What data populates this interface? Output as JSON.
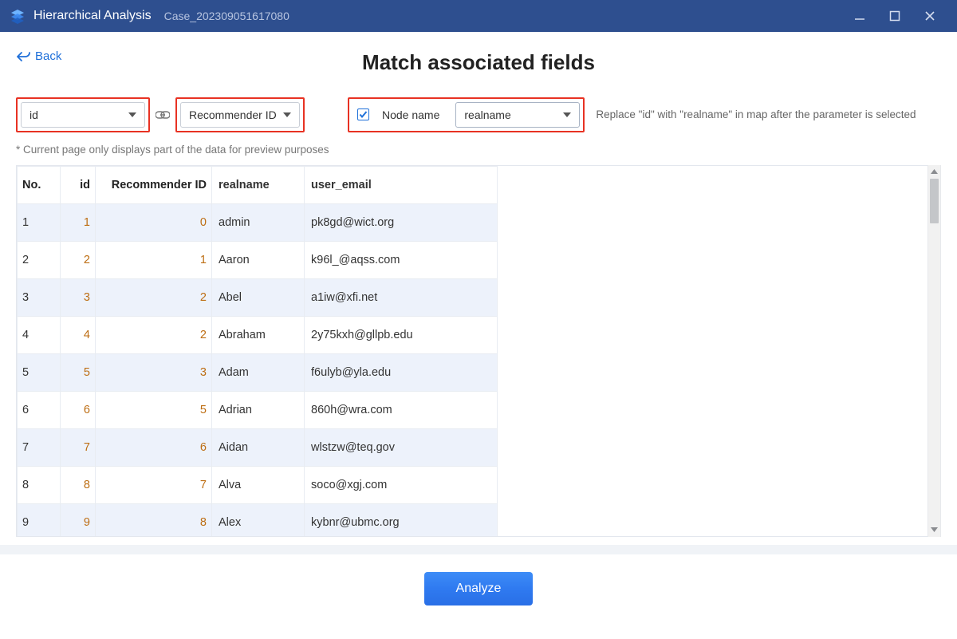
{
  "titlebar": {
    "app_title": "Hierarchical Analysis",
    "case_label": "Case_202309051617080"
  },
  "header": {
    "back_label": "Back",
    "page_title": "Match associated fields"
  },
  "controls": {
    "select_id_value": "id",
    "select_rec_value": "Recommender ID",
    "node_name_checked": true,
    "node_name_label": "Node name",
    "select_nodename_value": "realname",
    "help_text": "Replace \"id\" with \"realname\" in map after the parameter is selected"
  },
  "note_text": "* Current page only displays part of the data for preview purposes",
  "table": {
    "columns": [
      "No.",
      "id",
      "Recommender ID",
      "realname",
      "user_email"
    ],
    "rows": [
      {
        "no": "1",
        "id": "1",
        "rec": "0",
        "realname": "admin",
        "email": "pk8gd@wict.org"
      },
      {
        "no": "2",
        "id": "2",
        "rec": "1",
        "realname": "Aaron",
        "email": "k96l_@aqss.com"
      },
      {
        "no": "3",
        "id": "3",
        "rec": "2",
        "realname": "Abel",
        "email": "a1iw@xfi.net"
      },
      {
        "no": "4",
        "id": "4",
        "rec": "2",
        "realname": "Abraham",
        "email": "2y75kxh@gllpb.edu"
      },
      {
        "no": "5",
        "id": "5",
        "rec": "3",
        "realname": "Adam",
        "email": "f6ulyb@yla.edu"
      },
      {
        "no": "6",
        "id": "6",
        "rec": "5",
        "realname": "Adrian",
        "email": "860h@wra.com"
      },
      {
        "no": "7",
        "id": "7",
        "rec": "6",
        "realname": "Aidan",
        "email": "wlstzw@teq.gov"
      },
      {
        "no": "8",
        "id": "8",
        "rec": "7",
        "realname": "Alva",
        "email": "soco@xgj.com"
      },
      {
        "no": "9",
        "id": "9",
        "rec": "8",
        "realname": "Alex",
        "email": "kybnr@ubmc.org"
      }
    ]
  },
  "footer": {
    "analyze_label": "Analyze"
  }
}
